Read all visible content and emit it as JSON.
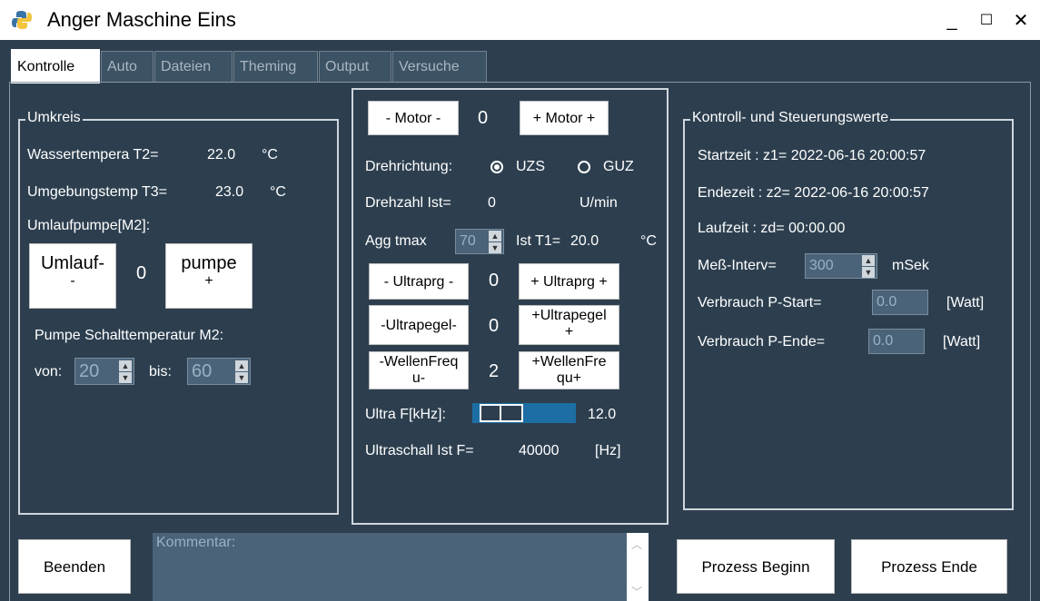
{
  "window": {
    "title": "Anger Maschine Eins",
    "minimize": "_",
    "maximize": "☐",
    "close": "✕"
  },
  "tabs": [
    "Kontrolle",
    "Auto",
    "Dateien",
    "Theming",
    "Output",
    "Versuche"
  ],
  "umkreis": {
    "title": "Umkreis",
    "wasser_label": "Wassertempera T2=",
    "wasser_value": "22.0",
    "wasser_unit": "°C",
    "umgebung_label": "Umgebungstemp T3=",
    "umgebung_value": "23.0",
    "umgebung_unit": "°C",
    "pumpe_label": "Umlaufpumpe[M2]:",
    "minus_line1": "Umlauf-",
    "minus_line2": "-",
    "pumpe_count": "0",
    "plus_line1": "pumpe",
    "plus_line2": "+",
    "schalt_label": "Pumpe Schalttemperatur M2:",
    "von_label": "von:",
    "von_value": "20",
    "bis_label": "bis:",
    "bis_value": "60"
  },
  "motor": {
    "minus": "- Motor -",
    "count": "0",
    "plus": "+ Motor +",
    "dreh_label": "Drehrichtung:",
    "uzs": "UZS",
    "guz": "GUZ",
    "drehzahl_label": "Drehzahl Ist=",
    "drehzahl_value": "0",
    "drehzahl_unit": "U/min",
    "agg_label": "Agg tmax",
    "agg_value": "70",
    "ist_t1_label": "Ist T1=",
    "ist_t1_value": "20.0",
    "ist_t1_unit": "°C",
    "ultraprg_minus": "- Ultraprg -",
    "ultraprg_count": "0",
    "ultraprg_plus": "+ Ultraprg +",
    "ultrapegel_minus": "-Ultrapegel-",
    "ultrapegel_count": "0",
    "ultrapegel_plus_l1": "+Ultrapegel",
    "ultrapegel_plus_l2": "+",
    "wellen_minus_l1": "-WellenFreq",
    "wellen_minus_l2": "u-",
    "wellen_count": "2",
    "wellen_plus_l1": "+WellenFre",
    "wellen_plus_l2": "qu+",
    "ultra_f_label": "Ultra F[kHz]:",
    "ultra_f_value": "12.0",
    "ultraschall_label": "Ultraschall Ist F=",
    "ultraschall_value": "40000",
    "ultraschall_unit": "[Hz]"
  },
  "kontroll": {
    "title": "Kontroll- und Steuerungswerte",
    "startzeit": "Startzeit : z1=  2022-06-16 20:00:57",
    "endezeit": "Endezeit : z2=  2022-06-16 20:00:57",
    "laufzeit": "Laufzeit  : zd=  00:00.00",
    "mess_label": "Meß-Interv=",
    "mess_value": "300",
    "mess_unit": "mSek",
    "p_start_label": "Verbrauch P-Start=",
    "p_start_value": "0.0",
    "p_start_unit": "[Watt]",
    "p_ende_label": "Verbrauch P-Ende=",
    "p_ende_value": "0.0",
    "p_ende_unit": "[Watt]"
  },
  "bottom": {
    "beenden": "Beenden",
    "kommentar_placeholder": "Kommentar:",
    "prozess_beginn": "Prozess Beginn",
    "prozess_ende": "Prozess Ende"
  }
}
